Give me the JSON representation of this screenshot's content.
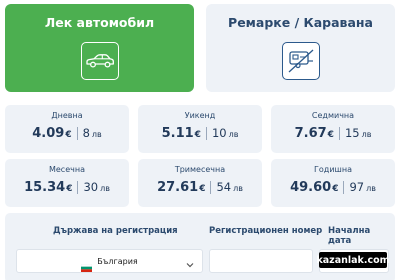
{
  "vehicle_types": [
    {
      "label": "Лек автомобил",
      "icon": "car-icon",
      "selected": true
    },
    {
      "label": "Ремарке / Каравана",
      "icon": "caravan-icon",
      "selected": false
    }
  ],
  "prices": [
    {
      "period": "Дневна",
      "eur": "4.09",
      "eur_symbol": "€",
      "bgn": "8",
      "bgn_symbol": "лв"
    },
    {
      "period": "Уикенд",
      "eur": "5.11",
      "eur_symbol": "€",
      "bgn": "10",
      "bgn_symbol": "лв"
    },
    {
      "period": "Седмична",
      "eur": "7.67",
      "eur_symbol": "€",
      "bgn": "15",
      "bgn_symbol": "лв"
    },
    {
      "period": "Месечна",
      "eur": "15.34",
      "eur_symbol": "€",
      "bgn": "30",
      "bgn_symbol": "лв"
    },
    {
      "period": "Тримесечна",
      "eur": "27.61",
      "eur_symbol": "€",
      "bgn": "54",
      "bgn_symbol": "лв"
    },
    {
      "period": "Годишна",
      "eur": "49.60",
      "eur_symbol": "€",
      "bgn": "97",
      "bgn_symbol": "лв"
    }
  ],
  "registration": {
    "country_label": "Държава на регистрация",
    "country_value": "България",
    "country_flag": "bulgaria-flag-icon",
    "plate_label": "Регистрационен номер",
    "plate_value": "",
    "date_label": "Начална дата",
    "date_value": ""
  },
  "watermark": "kazanlak.com",
  "colors": {
    "selected_green": "#4caf50",
    "card_bg": "#eef2f7",
    "text_navy": "#2c4a6e",
    "icon_blue": "#2c5a8c"
  }
}
